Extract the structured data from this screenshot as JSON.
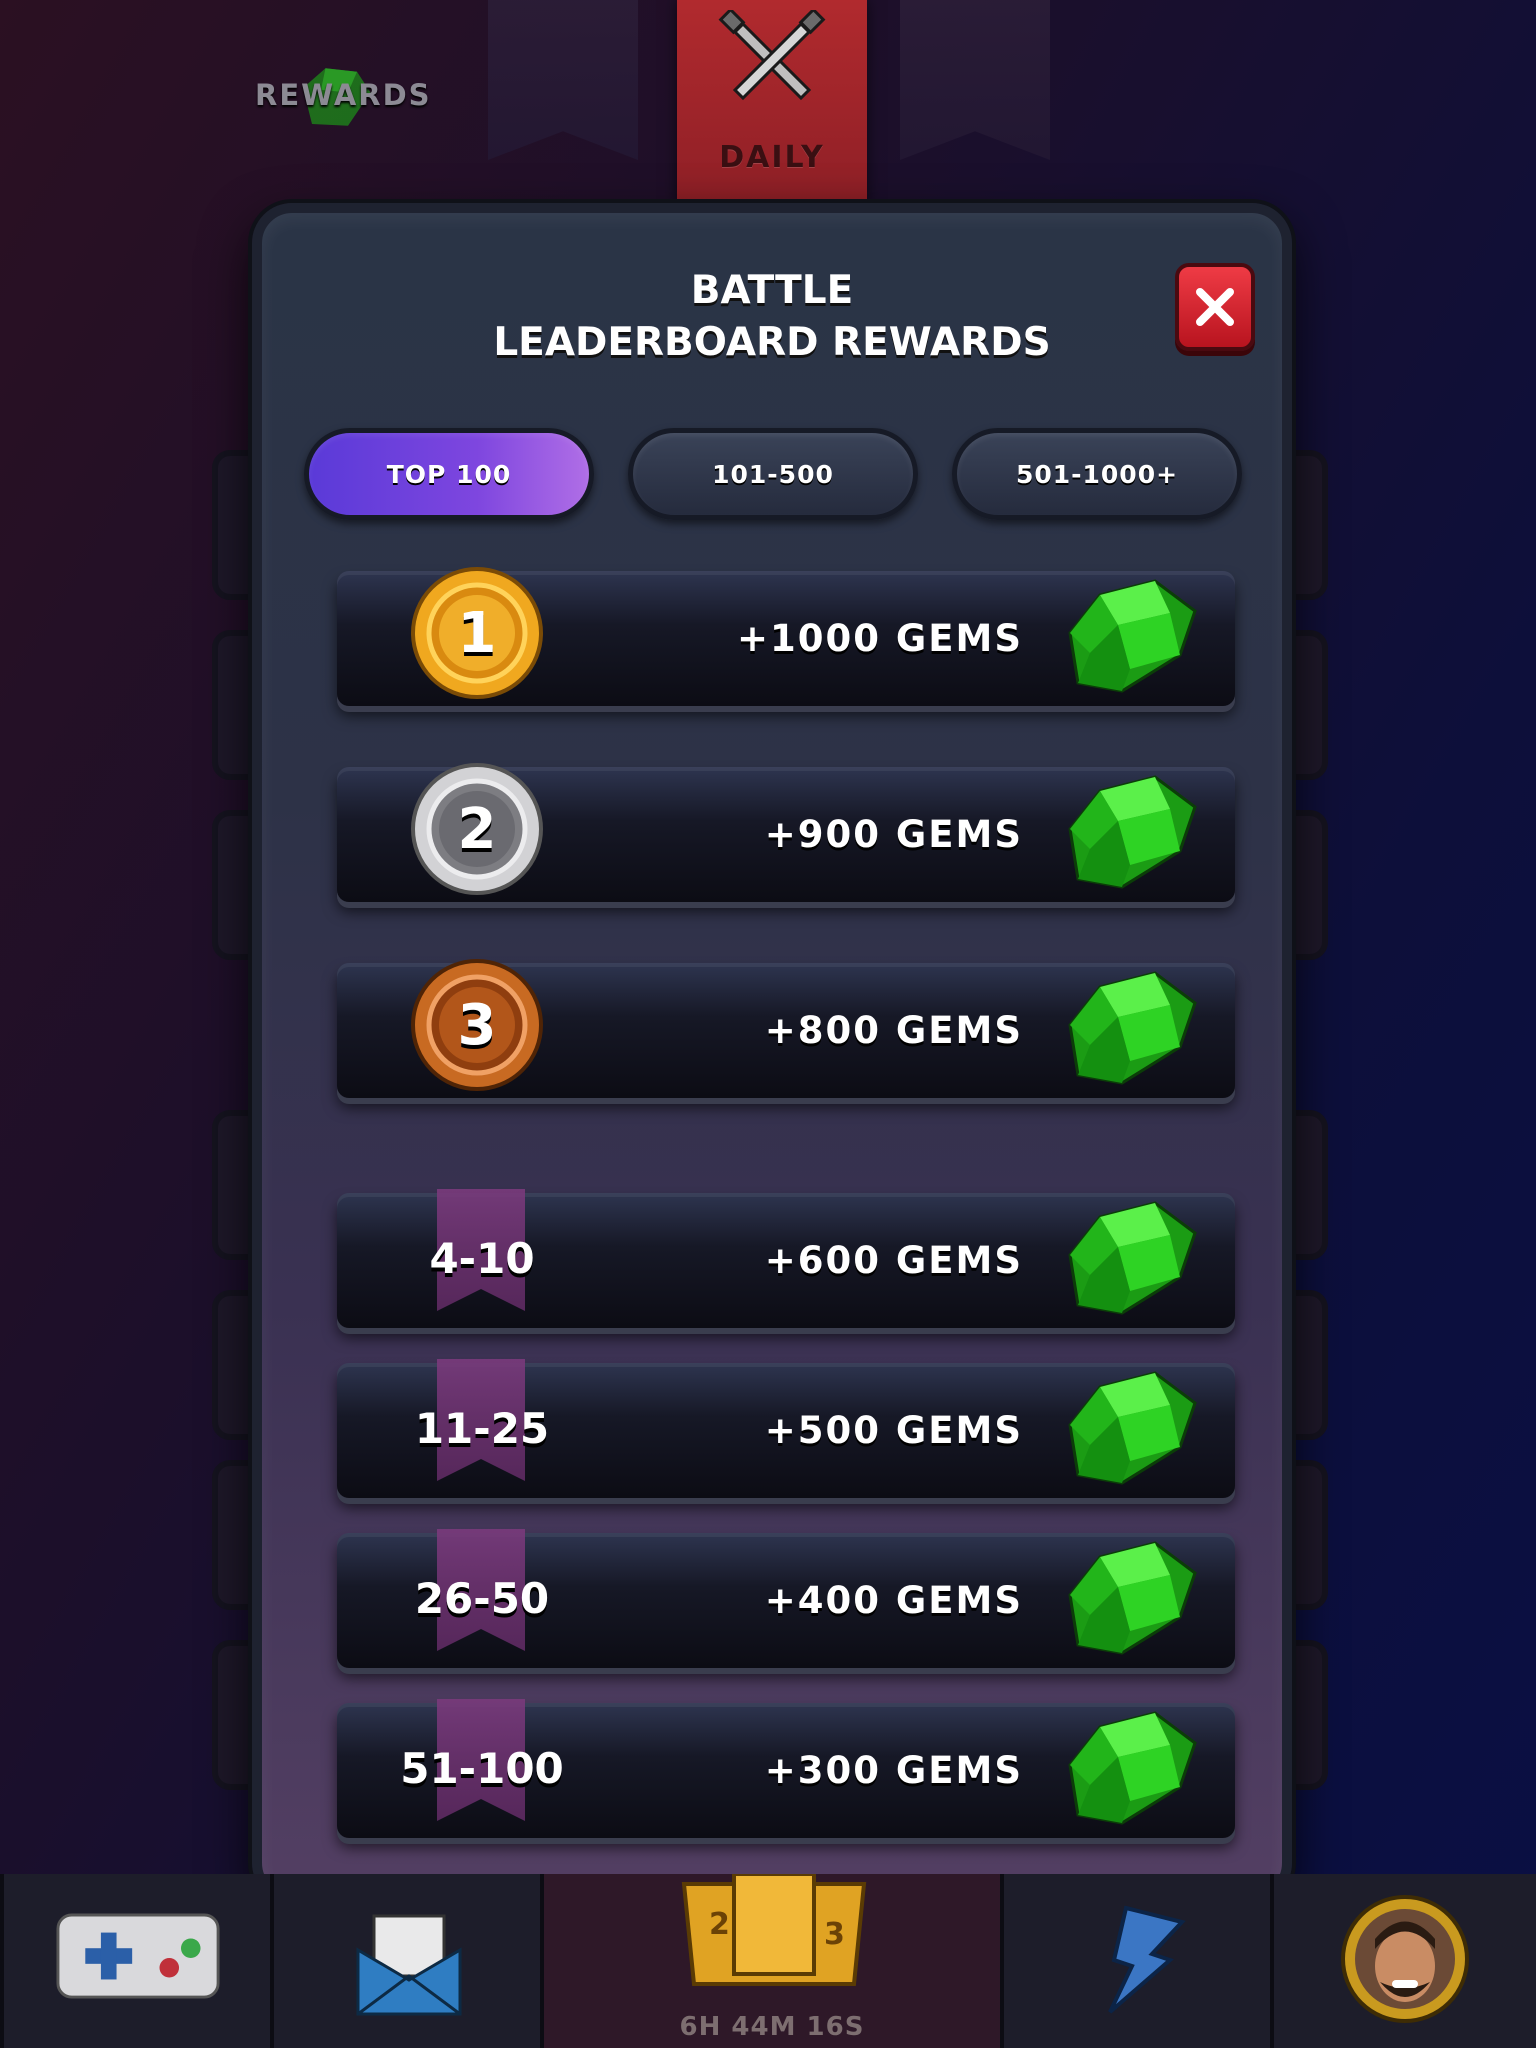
{
  "top_tabs": {
    "rewards_label": "REWARDS",
    "daily_label": "DAILY"
  },
  "modal": {
    "title_line1": "BATTLE",
    "title_line2": "LEADERBOARD REWARDS",
    "close_icon": "close-icon",
    "tabs": [
      {
        "label": "TOP 100",
        "active": true
      },
      {
        "label": "101-500",
        "active": false
      },
      {
        "label": "501-1000+",
        "active": false
      }
    ],
    "rewards": [
      {
        "rank": "1",
        "medal": "gold",
        "value": "+1000 GEMS"
      },
      {
        "rank": "2",
        "medal": "silver",
        "value": "+900 GEMS"
      },
      {
        "rank": "3",
        "medal": "bronze",
        "value": "+800 GEMS"
      },
      {
        "rank": "4-10",
        "medal": "ribbon",
        "value": "+600 GEMS"
      },
      {
        "rank": "11-25",
        "medal": "ribbon",
        "value": "+500 GEMS"
      },
      {
        "rank": "26-50",
        "medal": "ribbon",
        "value": "+400 GEMS"
      },
      {
        "rank": "51-100",
        "medal": "ribbon",
        "value": "+300 GEMS"
      }
    ]
  },
  "bottom_nav": {
    "items": [
      "gamepad-icon",
      "mail-icon",
      "leaderboard-podium-icon",
      "lightning-icon",
      "avatar"
    ],
    "timer": "6H 44M 16S"
  },
  "colors": {
    "accent_tab": "#7e46df",
    "close": "#d9232e",
    "gem": "#2fd82a",
    "gold": "#f2a51f",
    "silver": "#c9c9cc",
    "bronze": "#c4621c"
  }
}
